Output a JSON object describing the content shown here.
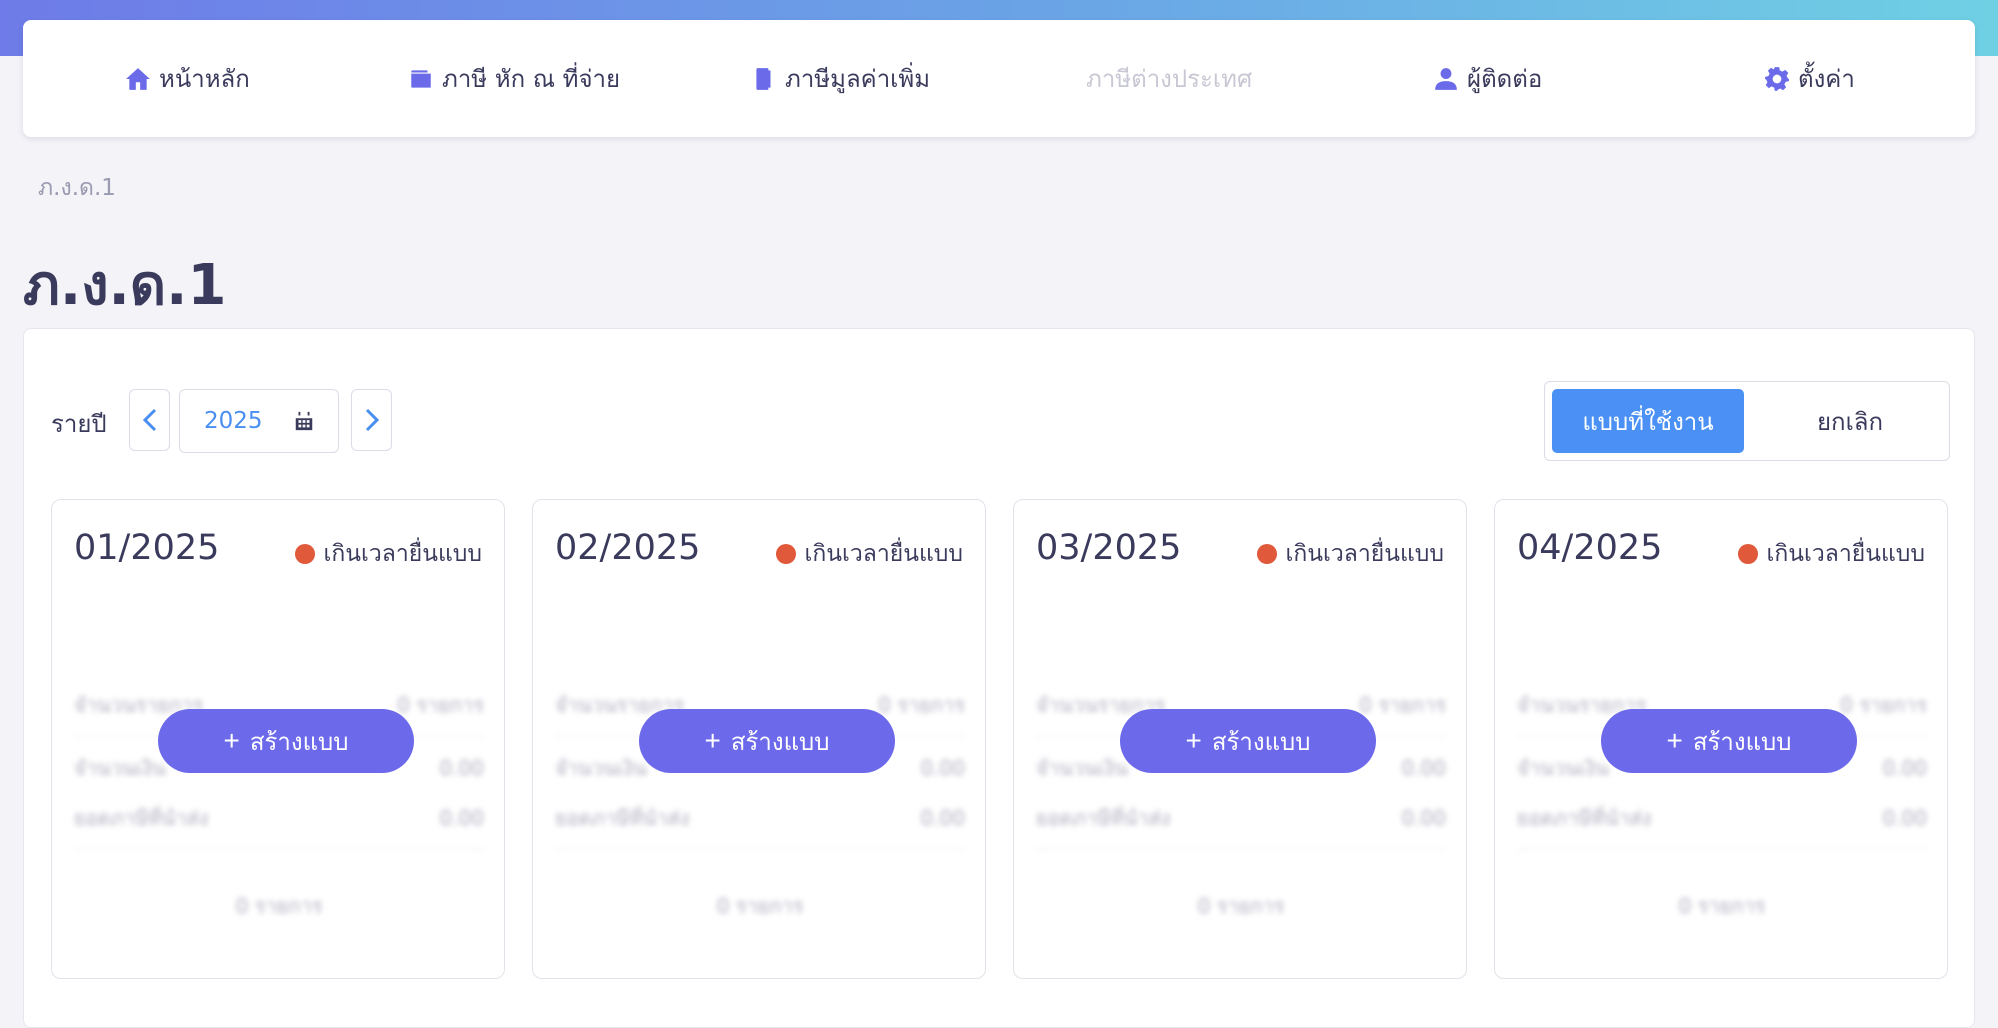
{
  "nav": {
    "items": [
      {
        "label": "หน้าหลัก",
        "icon": "home-icon"
      },
      {
        "label": "ภาษี หัก ณ ที่จ่าย",
        "icon": "wallet-icon"
      },
      {
        "label": "ภาษีมูลค่าเพิ่ม",
        "icon": "document-icon"
      },
      {
        "label": "ภาษีต่างประเทศ",
        "icon": "",
        "disabled": true
      },
      {
        "label": "ผู้ติดต่อ",
        "icon": "user-icon"
      },
      {
        "label": "ตั้งค่า",
        "icon": "gear-icon"
      }
    ]
  },
  "breadcrumb": "ภ.ง.ด.1",
  "page_title": "ภ.ง.ด.1",
  "filter": {
    "period_label": "รายปี",
    "year": "2025"
  },
  "segmented": {
    "active_label": "แบบที่ใช้งาน",
    "inactive_label": "ยกเลิก"
  },
  "cards": [
    {
      "period": "01/2025",
      "status": "เกินเวลายื่นแบบ",
      "create_label": "สร้างแบบ",
      "rows": [
        [
          "จำนวนรายการ",
          "0 รายการ"
        ],
        [
          "จำนวนเงิน",
          "0.00"
        ],
        [
          "ยอดภาษีที่นำส่ง",
          "0.00"
        ]
      ],
      "footer": "0 รายการ"
    },
    {
      "period": "02/2025",
      "status": "เกินเวลายื่นแบบ",
      "create_label": "สร้างแบบ",
      "rows": [
        [
          "จำนวนรายการ",
          "0 รายการ"
        ],
        [
          "จำนวนเงิน",
          "0.00"
        ],
        [
          "ยอดภาษีที่นำส่ง",
          "0.00"
        ]
      ],
      "footer": "0 รายการ"
    },
    {
      "period": "03/2025",
      "status": "เกินเวลายื่นแบบ",
      "create_label": "สร้างแบบ",
      "rows": [
        [
          "จำนวนรายการ",
          "0 รายการ"
        ],
        [
          "จำนวนเงิน",
          "0.00"
        ],
        [
          "ยอดภาษีที่นำส่ง",
          "0.00"
        ]
      ],
      "footer": "0 รายการ"
    },
    {
      "period": "04/2025",
      "status": "เกินเวลายื่นแบบ",
      "create_label": "สร้างแบบ",
      "rows": [
        [
          "จำนวนรายการ",
          "0 รายการ"
        ],
        [
          "จำนวนเงิน",
          "0.00"
        ],
        [
          "ยอดภาษีที่นำส่ง",
          "0.00"
        ]
      ],
      "footer": "0 รายการ"
    }
  ],
  "colors": {
    "accent": "#6c6aea",
    "primary_button": "#4a90f5",
    "status_overdue": "#e0593a"
  }
}
